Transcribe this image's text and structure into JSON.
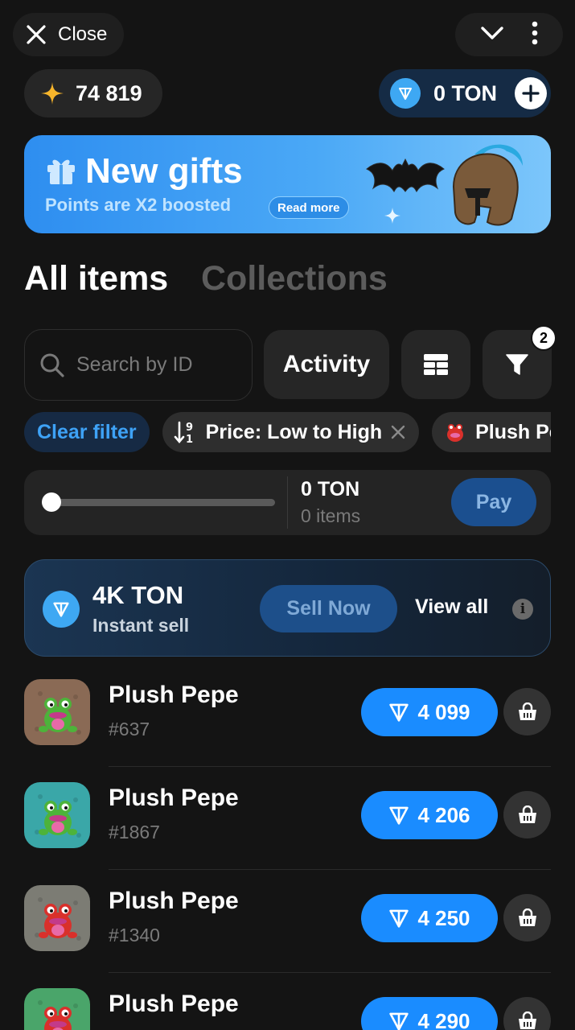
{
  "topbar": {
    "close_label": "Close"
  },
  "balance": {
    "points": "74 819",
    "ton": "0 TON"
  },
  "banner": {
    "title": "New gifts",
    "subtitle": "Points are X2 boosted",
    "read_more": "Read more"
  },
  "tabs": [
    {
      "label": "All items",
      "active": true
    },
    {
      "label": "Collections",
      "active": false
    }
  ],
  "toolbar": {
    "search_placeholder": "Search by ID",
    "activity_label": "Activity",
    "filter_count": "2"
  },
  "chips": {
    "clear": "Clear filter",
    "sort": "Price: Low to High",
    "collection": "Plush Pe"
  },
  "cart_summary": {
    "ton": "0 TON",
    "items": "0 items",
    "pay": "Pay"
  },
  "instant_sell": {
    "amount": "4K TON",
    "subtitle": "Instant sell",
    "sell_now": "Sell Now",
    "view_all": "View all"
  },
  "items": [
    {
      "name": "Plush Pepe",
      "number": "#637",
      "price": "4 099",
      "bg": "#8a6a55",
      "frog": "#4db33a"
    },
    {
      "name": "Plush Pepe",
      "number": "#1867",
      "price": "4 206",
      "bg": "#3aa7a8",
      "frog": "#4db33a"
    },
    {
      "name": "Plush Pepe",
      "number": "#1340",
      "price": "4 250",
      "bg": "#7c7c74",
      "frog": "#d9302b"
    },
    {
      "name": "Plush Pepe",
      "number": "",
      "price": "4 290",
      "bg": "#4aa56a",
      "frog": "#d9302b"
    }
  ],
  "colors": {
    "accent": "#1a8cff",
    "background": "#141414",
    "ton_blue": "#3ea8f3"
  }
}
